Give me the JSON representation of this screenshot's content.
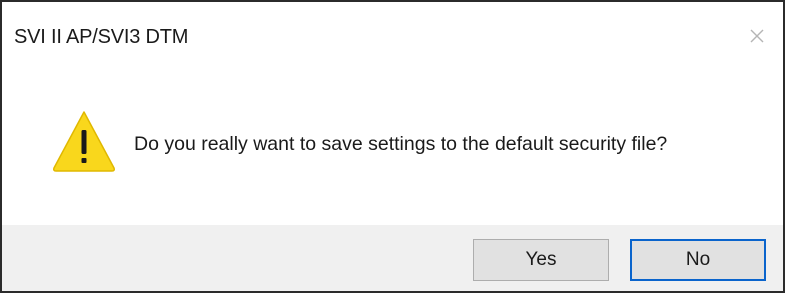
{
  "window": {
    "title": "SVI II AP/SVI3 DTM",
    "close_icon": "close-icon"
  },
  "dialog": {
    "icon": "warning-icon",
    "message": "Do you really want to save settings to the default security file?"
  },
  "buttons": {
    "yes_label": "Yes",
    "no_label": "No"
  },
  "colors": {
    "warning_fill": "#f9d71c",
    "focus_border": "#0a64cc",
    "footer_bg": "#f0f0f0"
  }
}
